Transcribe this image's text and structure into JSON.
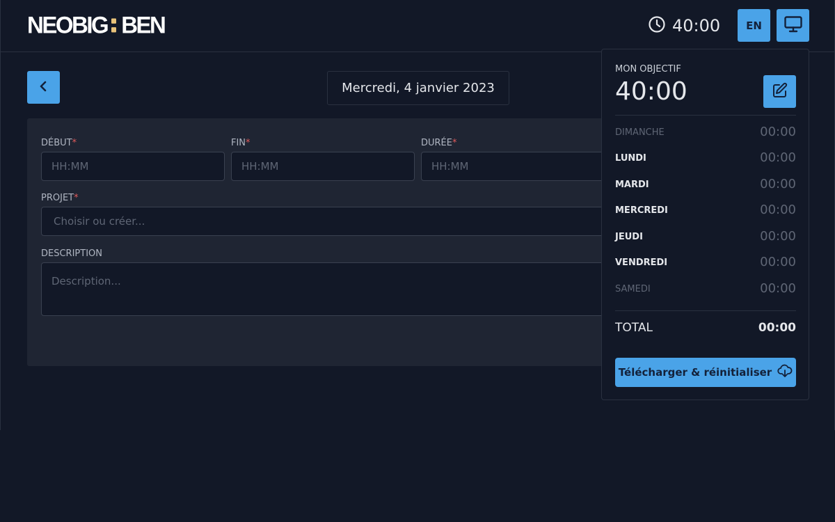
{
  "header": {
    "logo_left": "NEOBIG",
    "logo_right": "BEN",
    "timer_value": "40:00",
    "lang_label": "EN"
  },
  "main": {
    "date": "Mercredi, 4 janvier 2023",
    "form": {
      "start_label": "DÉBUT",
      "end_label": "FIN",
      "duration_label": "DURÉE",
      "project_label": "PROJET",
      "description_label": "DESCRIPTION",
      "required_mark": "*",
      "start_placeholder": "HH:MM",
      "end_placeholder": "HH:MM",
      "duration_placeholder": "HH:MM",
      "project_placeholder": "Choisir ou créer...",
      "description_placeholder": "Description..."
    }
  },
  "popover": {
    "goal_label": "MON OBJECTIF",
    "goal_value": "40:00",
    "days": [
      {
        "name": "DIMANCHE",
        "value": "00:00",
        "muted": true
      },
      {
        "name": "LUNDI",
        "value": "00:00",
        "muted": false
      },
      {
        "name": "MARDI",
        "value": "00:00",
        "muted": false
      },
      {
        "name": "MERCREDI",
        "value": "00:00",
        "muted": false
      },
      {
        "name": "JEUDI",
        "value": "00:00",
        "muted": false
      },
      {
        "name": "VENDREDI",
        "value": "00:00",
        "muted": false
      },
      {
        "name": "SAMEDI",
        "value": "00:00",
        "muted": true
      }
    ],
    "total_label": "TOTAL",
    "total_value": "00:00",
    "download_label": "Télécharger & réinitialiser"
  },
  "colors": {
    "background": "#121827",
    "card": "#1f2533",
    "accent": "#4aa3e8",
    "logo_accent": "#e9c37a",
    "required": "#e05a5a"
  },
  "icons": {
    "timer": "clock-icon",
    "display": "monitor-icon",
    "back": "chevron-left-icon",
    "edit": "edit-icon",
    "download": "cloud-download-icon"
  }
}
